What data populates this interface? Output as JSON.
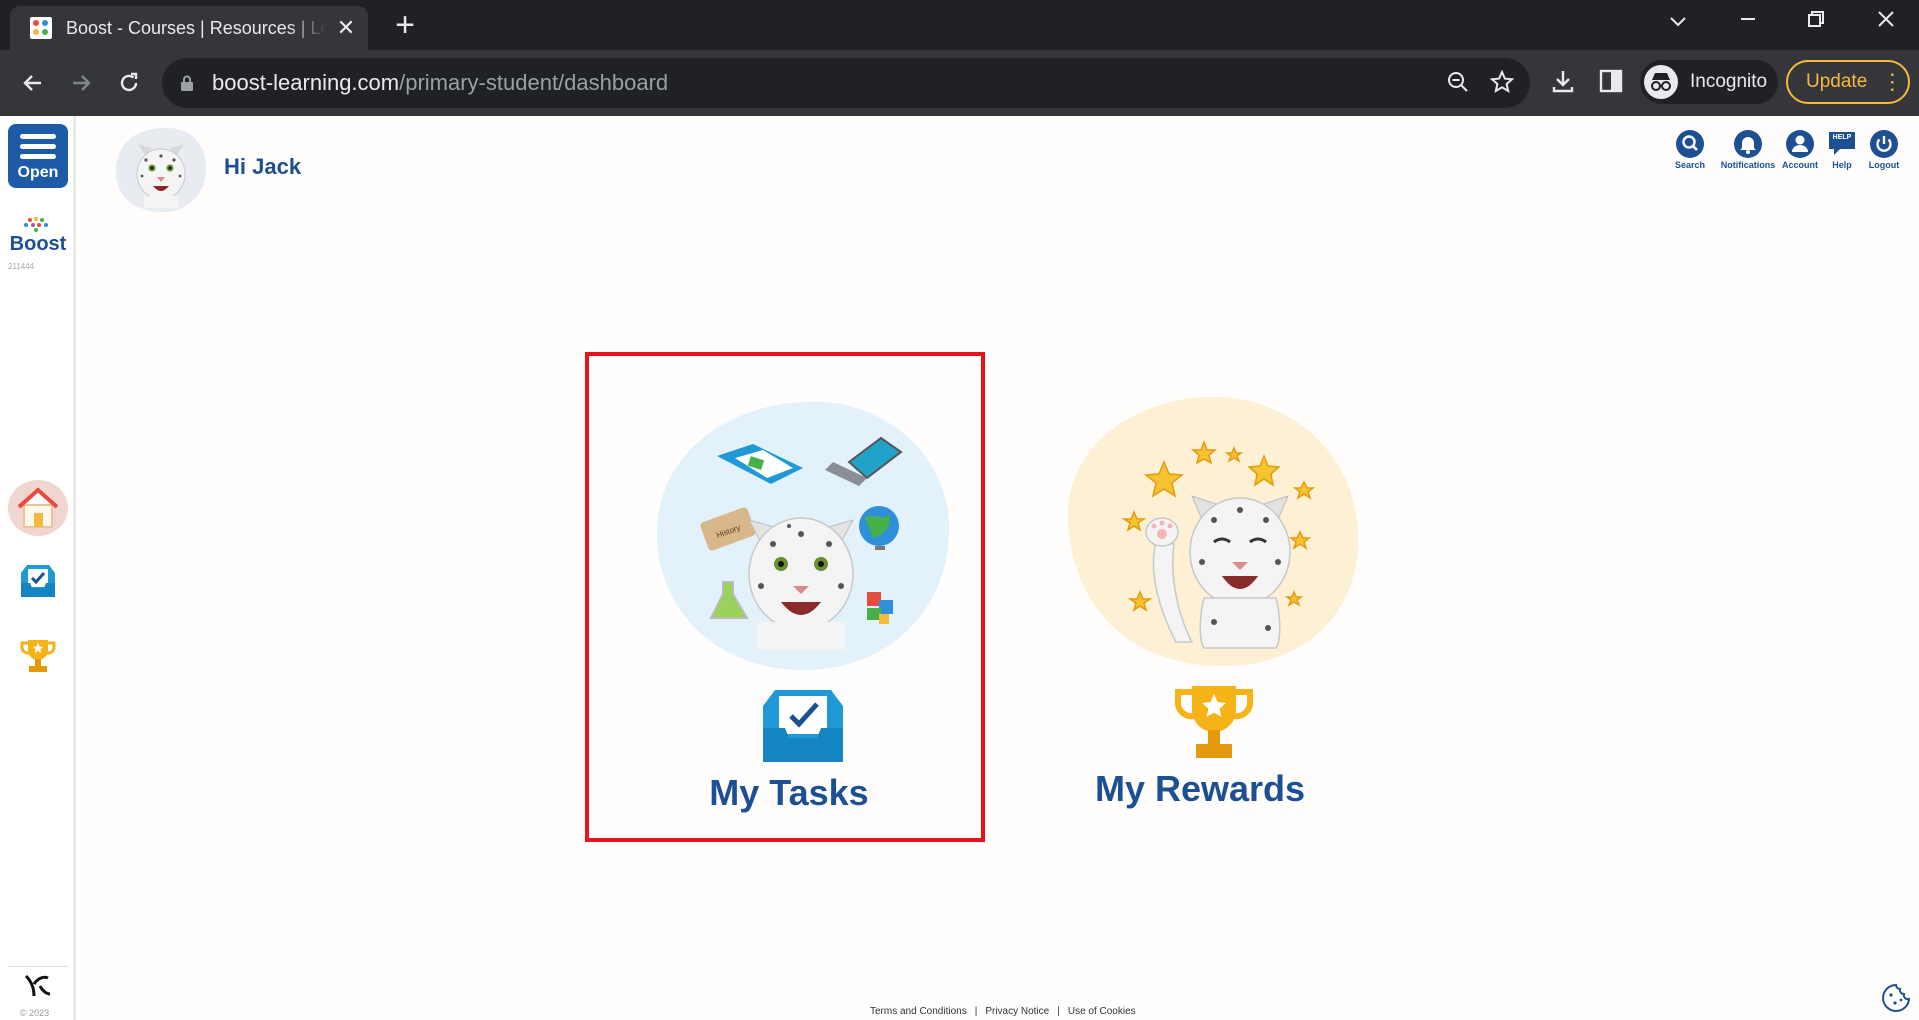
{
  "browser": {
    "tab_title": "Boost - Courses | Resources | Lessons",
    "new_tab_symbol": "+",
    "close_tab_symbol": "✕",
    "url_domain": "boost-learning.com",
    "url_path": "/primary-student/dashboard",
    "profile_label": "Incognito",
    "update_label": "Update"
  },
  "sidebar": {
    "open_label": "Open",
    "brand": "Boost",
    "school_id": "211444",
    "nav": [
      {
        "icon": "home-icon"
      },
      {
        "icon": "tasks-inbox-icon"
      },
      {
        "icon": "trophy-icon"
      }
    ],
    "copyright": "© 2023"
  },
  "header": {
    "greeting": "Hi Jack",
    "utilities": [
      {
        "label": "Search",
        "icon": "search-icon"
      },
      {
        "label": "Notifications",
        "icon": "bell-icon"
      },
      {
        "label": "Account",
        "icon": "account-icon"
      },
      {
        "label": "Help",
        "icon": "help-icon",
        "badge": "HELP"
      },
      {
        "label": "Logout",
        "icon": "power-icon"
      }
    ]
  },
  "cards": [
    {
      "title": "My Tasks",
      "icon": "tasks-inbox-icon",
      "selected": true
    },
    {
      "title": "My Rewards",
      "icon": "trophy-icon",
      "selected": false
    }
  ],
  "footer": {
    "links": [
      "Terms and Conditions",
      "Privacy Notice",
      "Use of Cookies"
    ],
    "separator": "|"
  },
  "colors": {
    "brand_blue": "#1d4f94",
    "highlight_red": "#e8141d",
    "tasks_blob": "#e3f1fb",
    "rewards_blob": "#fdf0d4"
  }
}
